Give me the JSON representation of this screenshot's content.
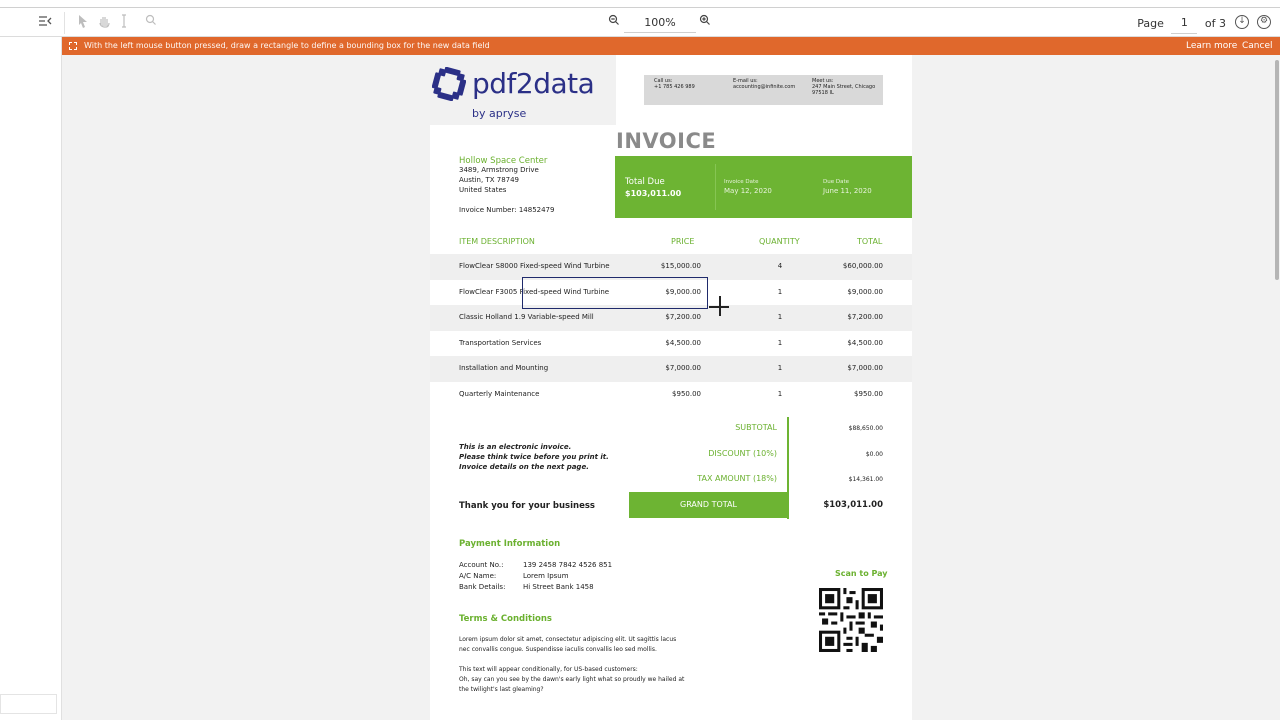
{
  "toolbar": {
    "zoom": "100%",
    "page_label": "Page",
    "page_current": "1",
    "page_total": "of 3"
  },
  "banner": {
    "message": "With the left mouse button pressed, draw a rectangle to define a bounding box for the new data field",
    "learn_more": "Learn more",
    "cancel": "Cancel"
  },
  "invoice": {
    "logo_text": "pdf2data",
    "logo_sub": "by apryse",
    "contact": {
      "call_label": "Call us:",
      "call_value": "+1 785 426 989",
      "email_label": "E-mail us:",
      "email_value": "accounting@infinite.com",
      "meet_label": "Meet us:",
      "meet_line1": "247 Main Street, Chicago",
      "meet_line2": "97518 IL"
    },
    "title": "INVOICE",
    "bill_to": {
      "name": "Hollow Space Center",
      "line1": "3489, Armstrong Drive",
      "line2": "Austin, TX 78749",
      "line3": "United States"
    },
    "invoice_number": "Invoice Number: 14852479",
    "total_due_label": "Total Due",
    "total_due_value": "$103,011.00",
    "invoice_date_label": "Invoice Date",
    "invoice_date_value": "May 12, 2020",
    "due_date_label": "Due Date",
    "due_date_value": "June 11, 2020",
    "columns": {
      "description": "ITEM DESCRIPTION",
      "price": "PRICE",
      "quantity": "QUANTITY",
      "total": "TOTAL"
    },
    "items": [
      {
        "description": "FlowClear S8000 Fixed-speed Wind Turbine",
        "price": "$15,000.00",
        "quantity": "4",
        "total": "$60,000.00"
      },
      {
        "description": "FlowClear F3005 Fixed-speed Wind Turbine",
        "price": "$9,000.00",
        "quantity": "1",
        "total": "$9,000.00"
      },
      {
        "description": "Classic Holland 1.9 Variable-speed Mill",
        "price": "$7,200.00",
        "quantity": "1",
        "total": "$7,200.00"
      },
      {
        "description": "Transportation Services",
        "price": "$4,500.00",
        "quantity": "1",
        "total": "$4,500.00"
      },
      {
        "description": "Installation and Mounting",
        "price": "$7,000.00",
        "quantity": "1",
        "total": "$7,000.00"
      },
      {
        "description": "Quarterly Maintenance",
        "price": "$950.00",
        "quantity": "1",
        "total": "$950.00"
      }
    ],
    "note_line1": "This is an electronic invoice.",
    "note_line2": "Please think twice before you print it.",
    "note_line3": "Invoice details on the next page.",
    "subtotal_label": "SUBTOTAL",
    "subtotal_value": "$88,650.00",
    "discount_label": "DISCOUNT (10%)",
    "discount_value": "$0.00",
    "tax_label": "TAX AMOUNT (18%)",
    "tax_value": "$14,361.00",
    "grand_total_label": "GRAND TOTAL",
    "grand_total_value": "$103,011.00",
    "thanks": "Thank you for your business",
    "payment_title": "Payment Information",
    "account_label": "Account No.:",
    "account_value": "139 2458 7842 4526 851",
    "ac_name_label": "A/C Name:",
    "ac_name_value": "Lorem Ipsum",
    "bank_label": "Bank Details:",
    "bank_value": "Hi Street Bank 1458",
    "scan_to_pay": "Scan to Pay",
    "terms_title": "Terms & Conditions",
    "terms_p1_line1": "Lorem ipsum dolor sit amet, consectetur adipiscing elit. Ut sagittis lacus",
    "terms_p1_line2": "nec convallis congue. Suspendisse iaculis convallis leo sed mollis.",
    "terms_p2_line1": "This text will appear conditionally, for US-based customers:",
    "terms_p2_line2": "Oh, say can you see by the dawn's early light what so proudly we hailed at",
    "terms_p2_line3": "the twilight's last gleaming?"
  },
  "colors": {
    "accent_orange": "#e0682c",
    "accent_green": "#6db433",
    "logo_blue": "#2b3087"
  }
}
